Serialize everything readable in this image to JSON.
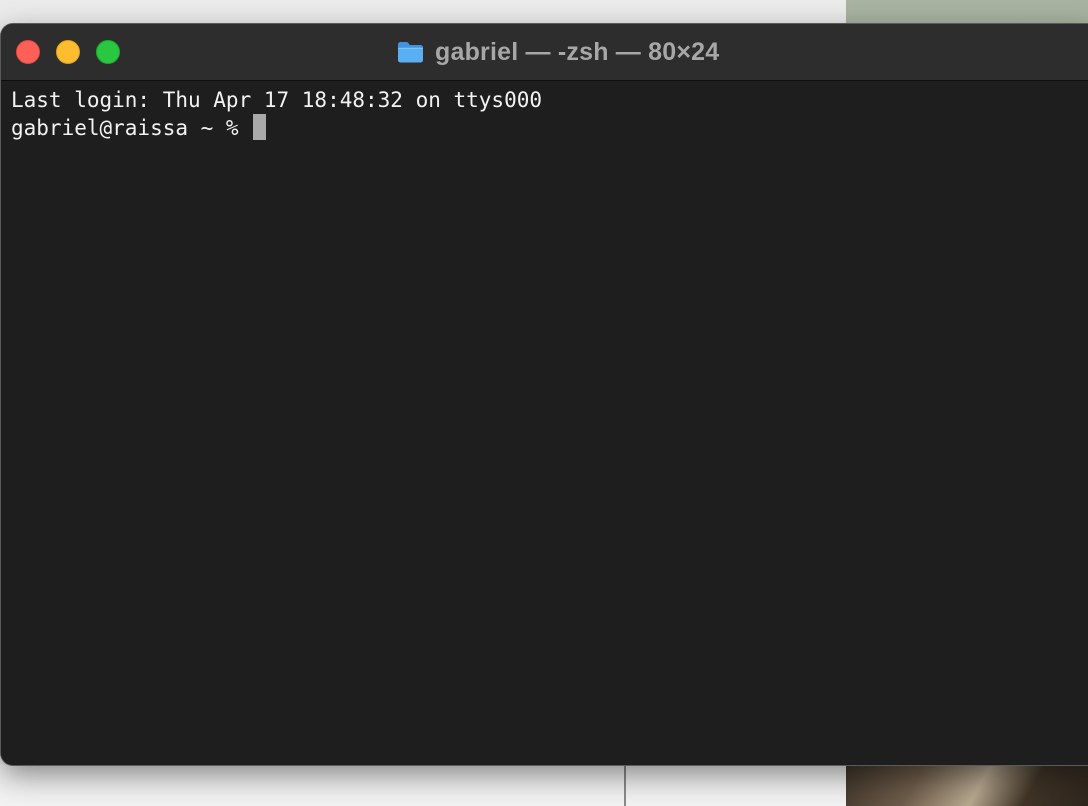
{
  "window": {
    "title": "gabriel — -zsh — 80×24",
    "title_icon": "folder-icon",
    "buttons": [
      "close",
      "minimize",
      "zoom"
    ]
  },
  "terminal": {
    "last_login_line": "Last login: Thu Apr 17 18:48:32 on ttys000",
    "prompt": "gabriel@raissa ~ % "
  },
  "colors": {
    "background": "#1e1e1e",
    "titlebar": "#2d2d2d",
    "text": "#f2f2f2",
    "cursor": "#a9a9a9",
    "close": "#fe5f57",
    "minimize": "#febc2e",
    "zoom": "#28c840",
    "folder": "#5aaef2"
  }
}
